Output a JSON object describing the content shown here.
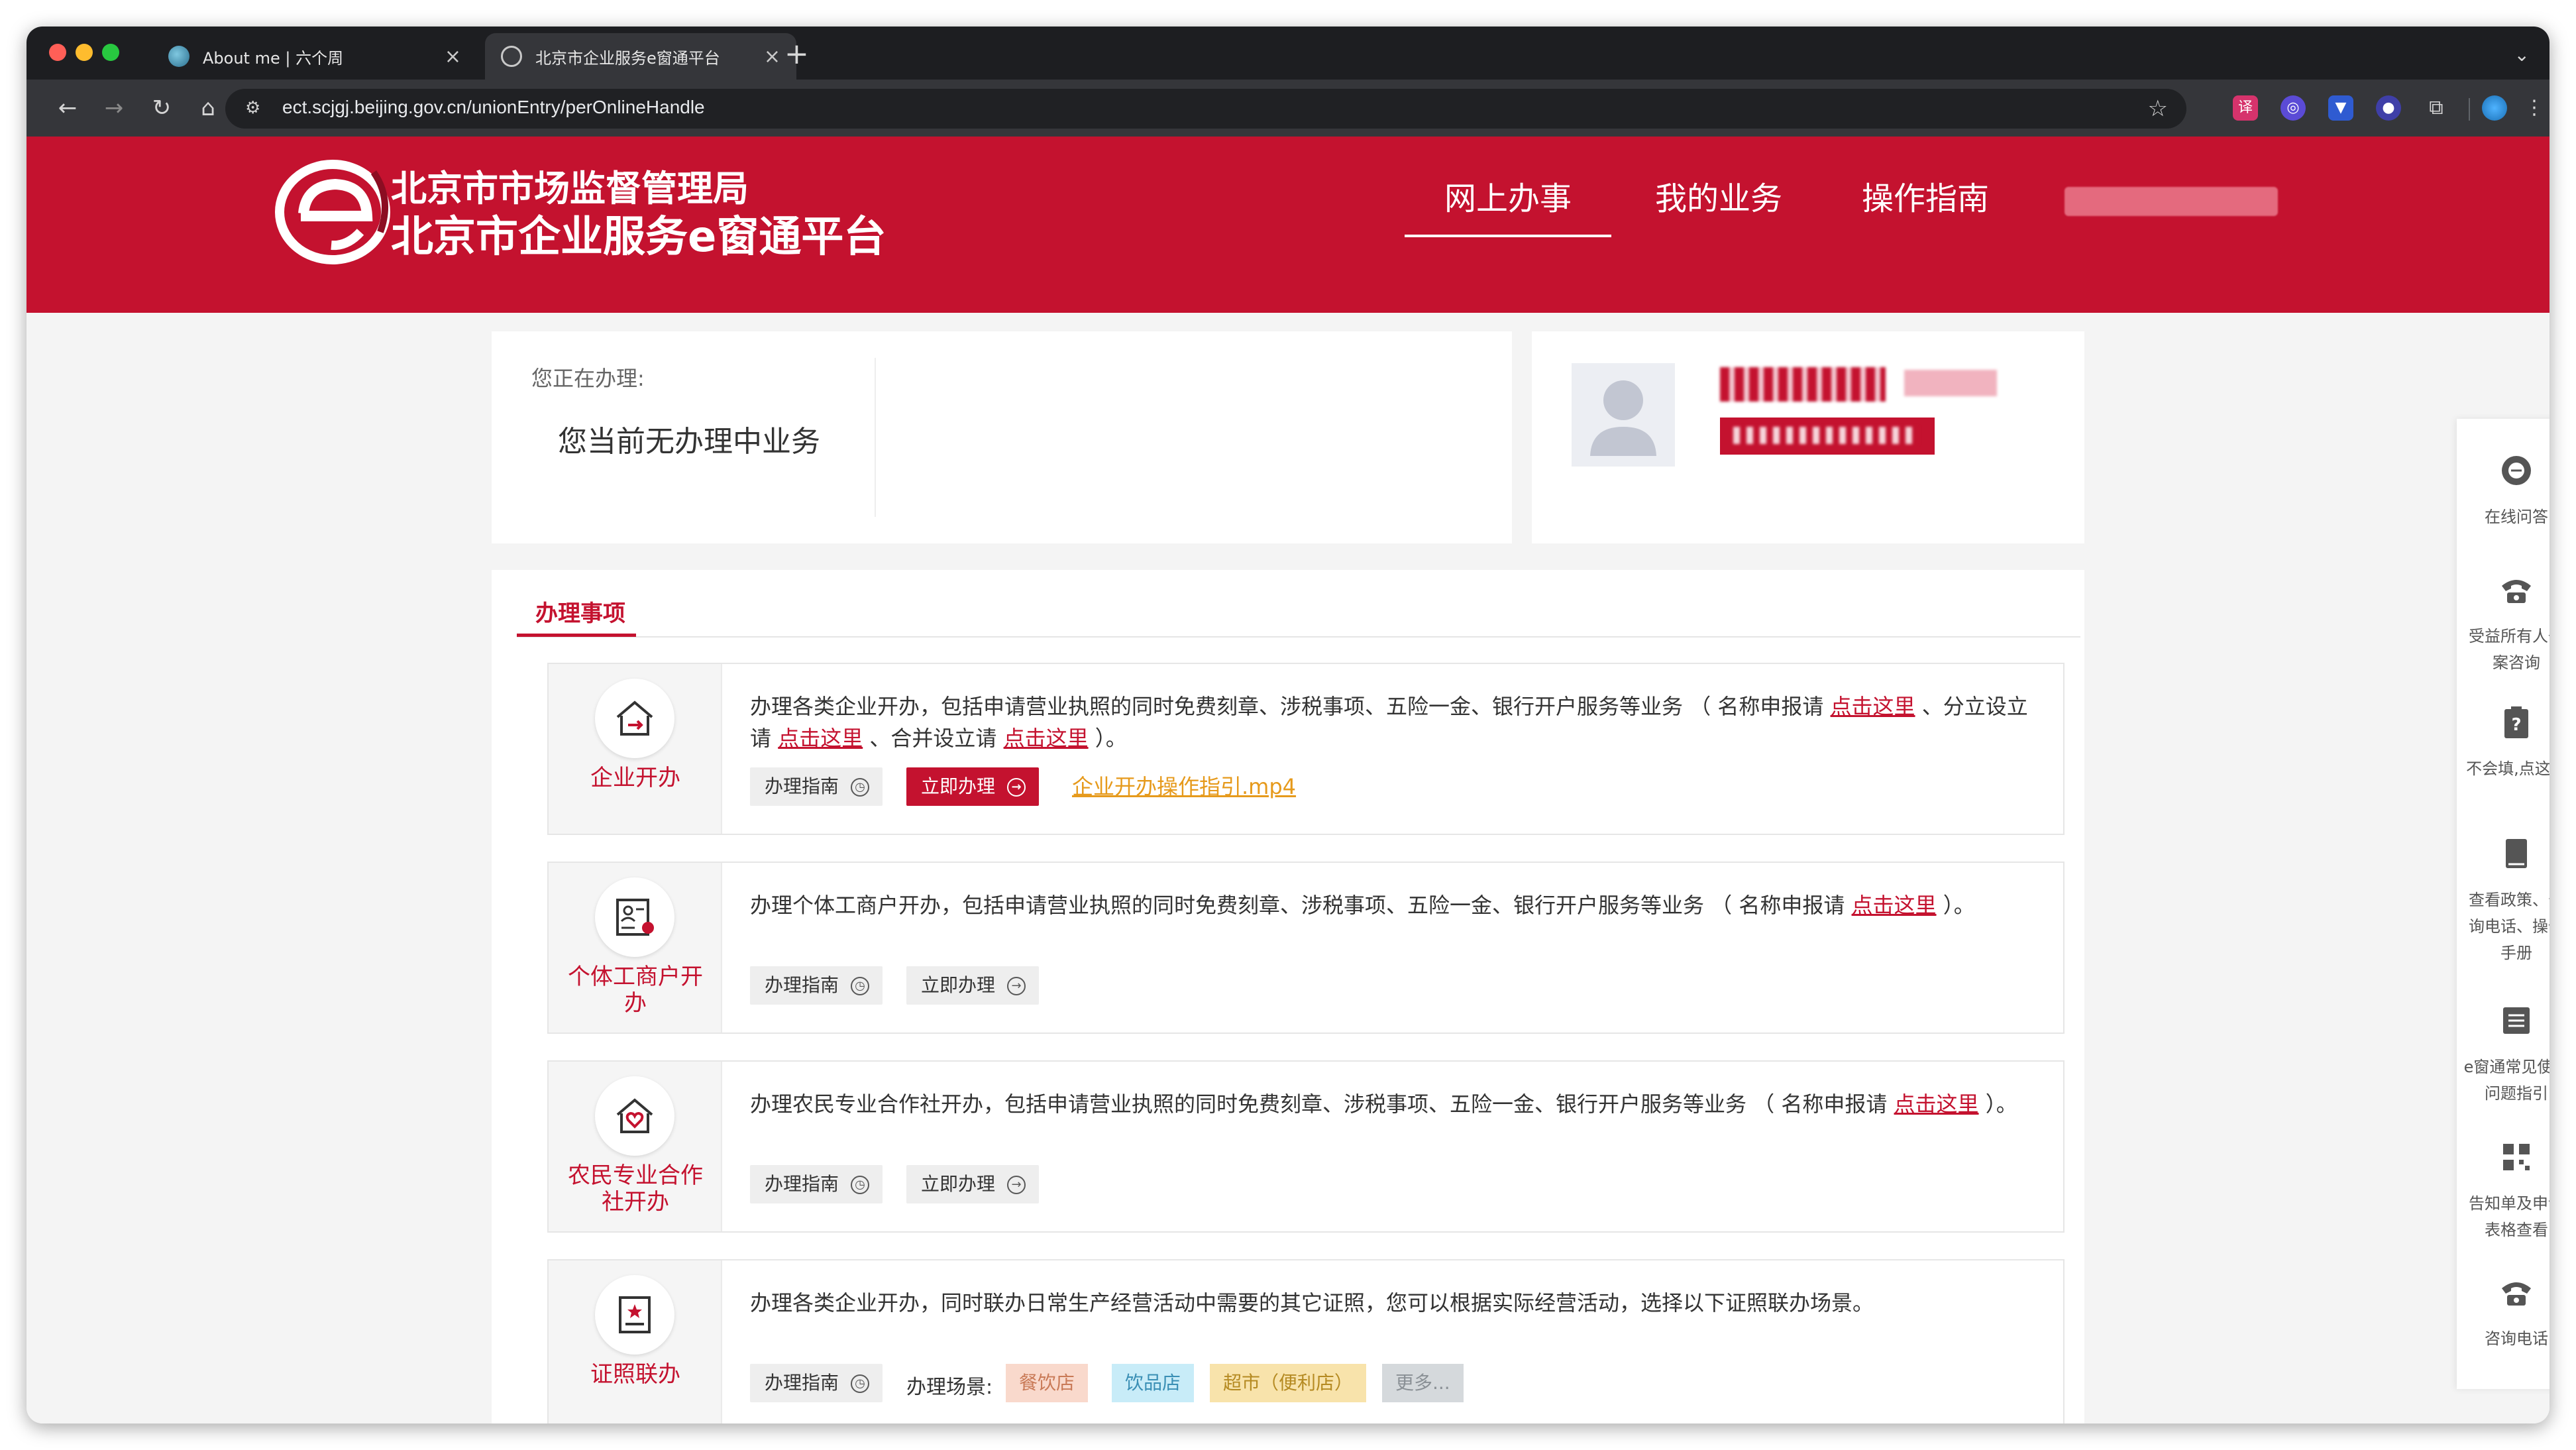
{
  "browser": {
    "tabs": [
      {
        "title": "About me | 六个周",
        "active": false
      },
      {
        "title": "北京市企业服务e窗通平台",
        "active": true
      }
    ],
    "new_tab": "+",
    "url": "ect.scjgj.beijing.gov.cn/unionEntry/perOnlineHandle"
  },
  "header": {
    "org_name": "北京市市场监督管理局",
    "platform_name": "北京市企业服务e窗通平台",
    "nav": [
      "网上办事",
      "我的业务",
      "操作指南"
    ],
    "active_nav": "网上办事",
    "brand_color": "#c4122f"
  },
  "current": {
    "label": "您正在办理:",
    "status": "您当前无办理中业务"
  },
  "section": {
    "title": "办理事项"
  },
  "items": [
    {
      "name": "企业开办",
      "icon": "house-arrow-icon",
      "desc_parts": {
        "a": "办理各类企业开办，包括申请营业执照的同时免费刻章、涉税事项、五险一金、银行开户服务等业务 （ 名称申报请 ",
        "b": "点击这里",
        "c": " 、分立设立请 ",
        "d": "点击这里",
        "e": " 、合并设立请 ",
        "f": "点击这里",
        "g": " ）。"
      },
      "guide_btn": "办理指南",
      "apply_btn": "立即办理",
      "video_link": "企业开办操作指引.mp4"
    },
    {
      "name": "个体工商户开办",
      "icon": "id-card-icon",
      "desc_parts": {
        "a": "办理个体工商户开办，包括申请营业执照的同时免费刻章、涉税事项、五险一金、银行开户服务等业务 （ 名称申报请 ",
        "b": "点击这里",
        "c": " ）。"
      },
      "guide_btn": "办理指南",
      "apply_btn": "立即办理"
    },
    {
      "name": "农民专业合作社开办",
      "icon": "house-heart-icon",
      "desc_parts": {
        "a": "办理农民专业合作社开办，包括申请营业执照的同时免费刻章、涉税事项、五险一金、银行开户服务等业务 （ 名称申报请 ",
        "b": "点击这里",
        "c": " ）。"
      },
      "guide_btn": "办理指南",
      "apply_btn": "立即办理"
    },
    {
      "name": "证照联办",
      "icon": "certificate-icon",
      "desc_parts": {
        "a": "办理各类企业开办，同时联办日常生产经营活动中需要的其它证照，您可以根据实际经营活动，选择以下证照联办场景。"
      },
      "guide_btn": "办理指南",
      "scene_label": "办理场景:",
      "scenes": [
        "餐饮店",
        "饮品店",
        "超市（便利店）",
        "更多..."
      ]
    }
  ],
  "rightbar": [
    {
      "label": "在线问答",
      "icon": "chat-bubble-icon"
    },
    {
      "label": "受益所有人备案咨询",
      "icon": "telephone-icon"
    },
    {
      "label": "不会填,点这里",
      "icon": "question-clipboard-icon"
    },
    {
      "label": "查看政策、咨询电话、操作手册",
      "icon": "book-icon"
    },
    {
      "label": "e窗通常见使用问题指引",
      "icon": "document-list-icon"
    },
    {
      "label": "告知单及申请表格查看",
      "icon": "qr-grid-icon"
    },
    {
      "label": "咨询电话",
      "icon": "telephone-icon"
    }
  ]
}
